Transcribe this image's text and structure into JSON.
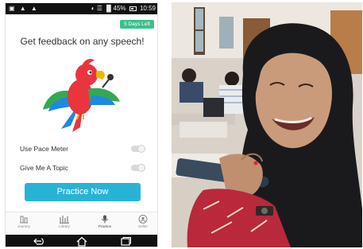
{
  "status_bar": {
    "left_icons": "▣ ▲ ▲",
    "right_text": "◐ ☰ ▐▌45%",
    "time": "10:59"
  },
  "trial_badge": "5 Days Left",
  "headline": "Get feedback on any speech!",
  "settings": [
    {
      "label": "Use Pace Meter",
      "enabled": false
    },
    {
      "label": "Give Me A Topic",
      "enabled": false
    }
  ],
  "practice_button": "Practice Now",
  "tabs": [
    {
      "label": "Journey",
      "icon": "journey-icon"
    },
    {
      "label": "Library",
      "icon": "library-icon"
    },
    {
      "label": "Practice",
      "icon": "microphone-icon"
    },
    {
      "label": "Softer",
      "icon": "profile-icon"
    }
  ],
  "nav_buttons": [
    "back-icon",
    "home-icon",
    "recent-apps-icon"
  ],
  "colors": {
    "accent": "#27b3d6",
    "badge": "#3bc18b",
    "parrot_body": "#e8363f",
    "parrot_wing": "#34a853",
    "parrot_tail": "#1e88e5",
    "parrot_beak": "#f5b400"
  },
  "photo": {
    "subject": "student-in-black-hijab-speaking-into-phone"
  }
}
